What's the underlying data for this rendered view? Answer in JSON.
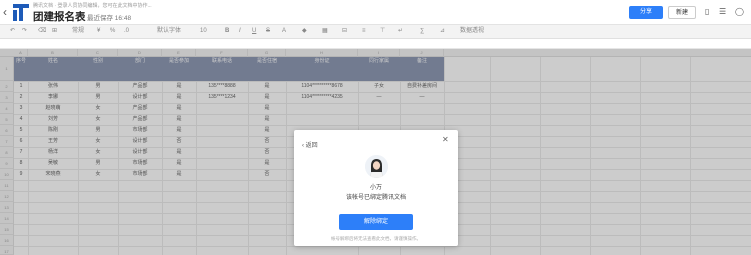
{
  "header": {
    "back_icon": "chevron-left-icon",
    "notice": "腾讯文档 · 登录人员协同编辑，您可在此文档中协作...",
    "title": "团建报名表",
    "save_status": "最近保存 16:48",
    "share_label": "分享",
    "new_label": "新建",
    "device_icon": "mobile-icon",
    "menu_icon": "menu-icon",
    "avatar_icon": "user-icon"
  },
  "toolbar": {
    "items": [
      "↶",
      "↷",
      "⌫",
      "⊞",
      "常规",
      "¥",
      "%",
      ".0",
      "默认字体",
      "10",
      "B",
      "I",
      "U",
      "S",
      "A",
      "◆",
      "▦",
      "⊟",
      "≡",
      "⊤",
      "↵",
      "∑",
      "⊿",
      "数据透视"
    ]
  },
  "sheet": {
    "column_letters": [
      "A",
      "B",
      "C",
      "D",
      "E",
      "F",
      "G",
      "H",
      "I",
      "J"
    ],
    "row_numbers": [
      "1",
      "2",
      "3",
      "4",
      "5",
      "6",
      "7",
      "8",
      "9",
      "10",
      "11",
      "12",
      "13",
      "14",
      "15",
      "16",
      "17"
    ],
    "headers": [
      "序号",
      "姓名",
      "性别",
      "部门",
      "是否参加",
      "联系电话",
      "是否住宿",
      "身份证",
      "同行家属",
      "备注"
    ],
    "rows": [
      [
        "1",
        "张伟",
        "男",
        "产品部",
        "是",
        "135****8888",
        "是",
        "1104**********8678",
        "子女",
        "自费补差房间"
      ],
      [
        "2",
        "李娜",
        "男",
        "设计部",
        "是",
        "135****1234",
        "是",
        "1104**********4235",
        "—",
        "—"
      ],
      [
        "3",
        "赵晓萌",
        "女",
        "产品部",
        "是",
        "",
        "是",
        "",
        "",
        ""
      ],
      [
        "4",
        "刘芳",
        "女",
        "产品部",
        "是",
        "",
        "是",
        "",
        "",
        ""
      ],
      [
        "5",
        "陈刚",
        "男",
        "市场部",
        "是",
        "",
        "是",
        "",
        "",
        ""
      ],
      [
        "6",
        "王芳",
        "女",
        "设计部",
        "否",
        "",
        "否",
        "",
        "",
        ""
      ],
      [
        "7",
        "杨洋",
        "女",
        "设计部",
        "是",
        "",
        "否",
        "",
        "",
        ""
      ],
      [
        "8",
        "吴敏",
        "男",
        "市场部",
        "是",
        "",
        "是",
        "",
        "",
        ""
      ],
      [
        "9",
        "宋晓燕",
        "女",
        "市场部",
        "是",
        "",
        "否",
        "",
        "",
        ""
      ]
    ]
  },
  "modal": {
    "back_label": "返回",
    "close_icon": "close-icon",
    "avatar_icon": "user-avatar-icon",
    "user_name": "小万",
    "description": "该帐号已绑定腾讯文档",
    "unbind_label": "解除绑定",
    "note": "帐号解绑后将无法查看此文档，请谨慎操作。"
  },
  "colors": {
    "accent": "#2d7ff9",
    "table_header_bg": "#8f9ab5"
  }
}
